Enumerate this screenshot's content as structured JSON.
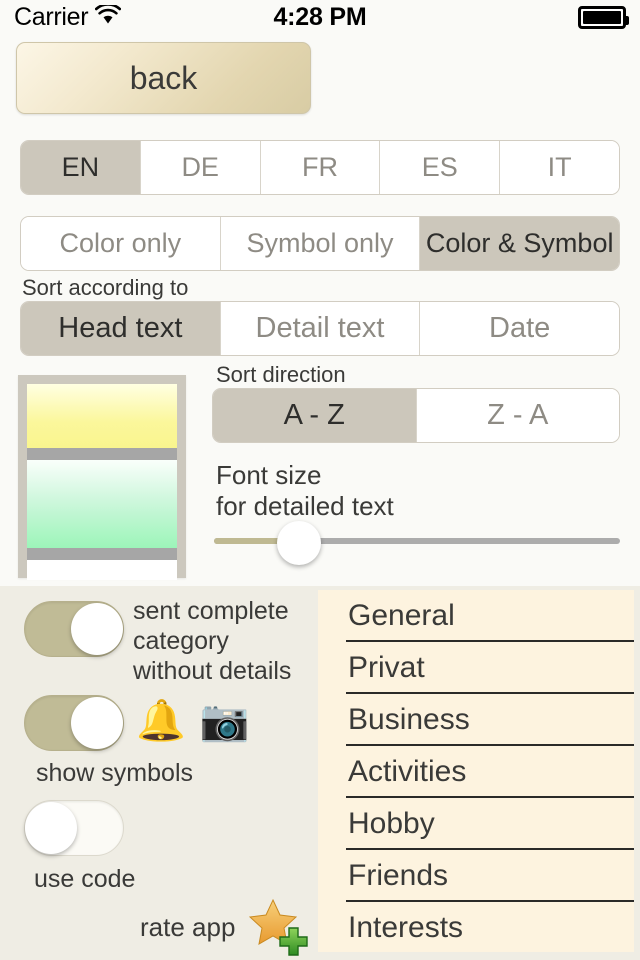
{
  "status_bar": {
    "carrier": "Carrier",
    "wifi_icon": "wifi-icon",
    "time": "4:28 PM",
    "battery_icon": "battery-full-icon"
  },
  "nav": {
    "back_label": "back"
  },
  "language_segment": {
    "options": [
      "EN",
      "DE",
      "FR",
      "ES",
      "IT"
    ],
    "selected": "EN"
  },
  "display_mode_segment": {
    "options": [
      "Color only",
      "Symbol only",
      "Color & Symbol"
    ],
    "selected": "Color & Symbol"
  },
  "sort_by": {
    "label": "Sort according to",
    "options": [
      "Head text",
      "Detail text",
      "Date"
    ],
    "selected": "Head text"
  },
  "sort_direction": {
    "label": "Sort direction",
    "options": [
      "A - Z",
      "Z - A"
    ],
    "selected": "A - Z"
  },
  "font_size": {
    "label_line1": "Font size",
    "label_line2": "for detailed text",
    "value_percent": 21
  },
  "preview": {
    "name": "color-scheme-preview",
    "band_colors": [
      "#F9F58E",
      "#A6A6A6",
      "#9CF5B9",
      "#A6A6A6",
      "#FFFFFF"
    ]
  },
  "toggles": [
    {
      "name": "sent-complete-category",
      "label": "sent complete category without details",
      "state": "on"
    },
    {
      "name": "show-symbols",
      "label": "show symbols",
      "state": "on"
    },
    {
      "name": "use-code",
      "label": "use code",
      "state": "off"
    }
  ],
  "symbol_icons": [
    "bell-ringing-icon",
    "camera-icon"
  ],
  "rate_app": {
    "label": "rate app",
    "icon": "star-plus-icon"
  },
  "categories": {
    "items": [
      "General",
      "Privat",
      "Business",
      "Activities",
      "Hobby",
      "Friends",
      "Interests"
    ]
  },
  "colors": {
    "page_background": "#FAFAF7",
    "bottom_background": "#EFEDE4",
    "segment_selected": "#CCC7BB",
    "toggle_on_track": "#C0BB96",
    "slider_fill": "#BFB992",
    "list_background": "#FDF3DF",
    "back_button_gradient_start": "#FCF6E6",
    "back_button_gradient_end": "#D8CCA4"
  }
}
